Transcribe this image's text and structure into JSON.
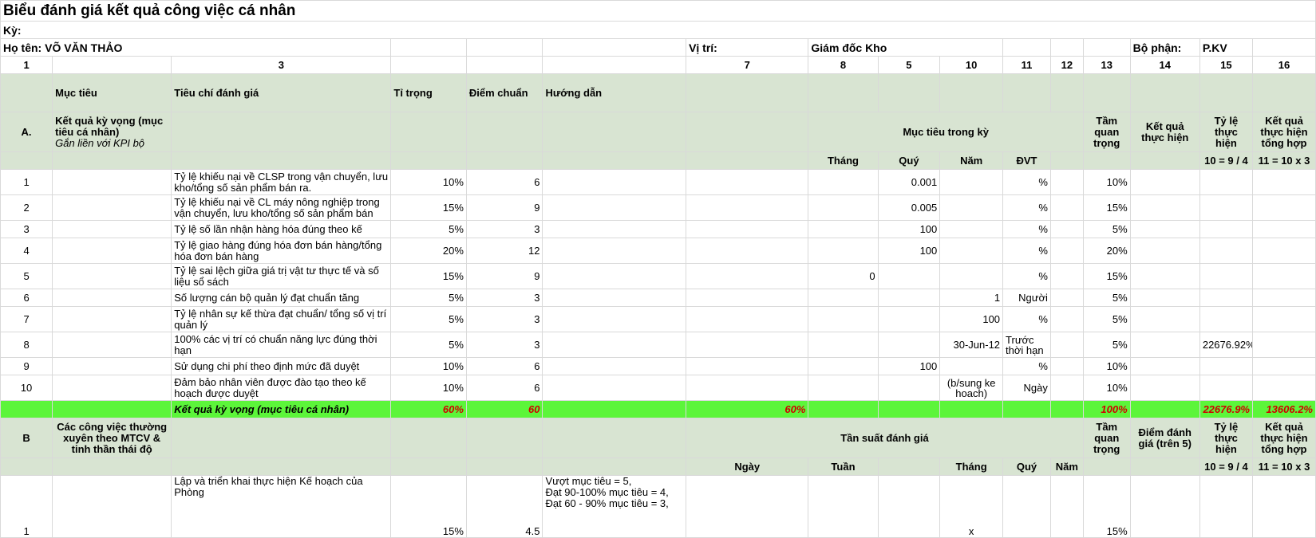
{
  "title": "Biểu đánh giá kết quả công việc cá nhân",
  "ky_label": "Kỳ:",
  "name_label": "Họ tên: VÕ VĂN THẢO",
  "position_label": "Vị trí:",
  "position_value": "Giám đốc Kho",
  "dept_label": "Bộ phận:",
  "dept_value": "P.KV",
  "col_numbers": [
    "1",
    "",
    "3",
    "",
    "",
    "",
    "7",
    "8",
    "5",
    "10",
    "11",
    "12",
    "13",
    "14",
    "15",
    "16"
  ],
  "header": {
    "muc_tieu": "Mục tiêu",
    "tieu_chi": "Tiêu chí đánh giá",
    "ti_trong": "Tỉ trọng",
    "diem_chuan": "Điểm chuẩn",
    "huong_dan": "Hướng dẫn"
  },
  "section_a": {
    "code": "A.",
    "title": "Kết quả kỳ vọng (mục tiêu cá nhân)",
    "subtitle": "Gắn liền với KPI bộ",
    "period_target": "Mục tiêu trong kỳ",
    "importance": "Tầm quan trọng",
    "result": "Kết quả thực hiện",
    "rate": "Tỷ lệ thực hiện",
    "total": "Kết quả thực hiện tổng hợp",
    "sub_cols": [
      "Tháng",
      "Quý",
      "Năm",
      "ĐVT"
    ],
    "formula_rate": "10 = 9 / 4",
    "formula_total": "11 = 10 x 3"
  },
  "rows_a": [
    {
      "no": "1",
      "criteria": "Tỷ lệ khiếu nại về CLSP trong vận chuyển, lưu kho/tổng số sản phẩm bán ra.",
      "weight": "10%",
      "score": "6",
      "thang": "",
      "quy": "0.001",
      "nam": "",
      "dvt": "%",
      "imp": "10%",
      "rate": ""
    },
    {
      "no": "2",
      "criteria": "Tỷ lệ khiếu nại về CL máy nông nghiệp  trong vận chuyển, lưu kho/tổng số sản phẩm bán",
      "weight": "15%",
      "score": "9",
      "thang": "",
      "quy": "0.005",
      "nam": "",
      "dvt": "%",
      "imp": "15%",
      "rate": ""
    },
    {
      "no": "3",
      "criteria": "Tỷ lệ số lần nhận hàng hóa đúng theo kế",
      "weight": "5%",
      "score": "3",
      "thang": "",
      "quy": "100",
      "nam": "",
      "dvt": "%",
      "imp": "5%",
      "rate": ""
    },
    {
      "no": "4",
      "criteria": "Tỷ lệ giao hàng đúng hóa đơn bán hàng/tổng hóa đơn bán hàng",
      "weight": "20%",
      "score": "12",
      "thang": "",
      "quy": "100",
      "nam": "",
      "dvt": "%",
      "imp": "20%",
      "rate": ""
    },
    {
      "no": "5",
      "criteria": "Tỷ lệ sai lệch giữa giá trị vật tư thực tế và số liệu sổ sách",
      "weight": "15%",
      "score": "9",
      "thang": "0",
      "quy": "",
      "nam": "",
      "dvt": "%",
      "imp": "15%",
      "rate": ""
    },
    {
      "no": "6",
      "criteria": "Số lượng cán bộ quản lý đạt chuẩn tăng",
      "weight": "5%",
      "score": "3",
      "thang": "",
      "quy": "",
      "nam": "1",
      "dvt": "Người",
      "imp": "5%",
      "rate": ""
    },
    {
      "no": "7",
      "criteria": "Tỷ lệ nhân sự kế thừa đạt chuẩn/ tổng số vị trí quản lý",
      "weight": "5%",
      "score": "3",
      "thang": "",
      "quy": "",
      "nam": "100",
      "dvt": "%",
      "imp": "5%",
      "rate": ""
    },
    {
      "no": "8",
      "criteria": "100% các vị trí có chuẩn năng lực đúng thời hạn",
      "weight": "5%",
      "score": "3",
      "thang": "",
      "quy": "",
      "nam": "30-Jun-12",
      "dvt": "Trước thời hạn",
      "imp": "5%",
      "rate": "22676.92%"
    },
    {
      "no": "9",
      "criteria": "Sử dụng chi phí theo định mức đã duyệt",
      "weight": "10%",
      "score": "6",
      "thang": "",
      "quy": "100",
      "nam": "",
      "dvt": "%",
      "imp": "10%",
      "rate": ""
    },
    {
      "no": "10",
      "criteria": "Đảm bảo nhân viên được đào tạo theo kế hoạch được duyệt",
      "weight": "10%",
      "score": "6",
      "thang": "",
      "quy": "",
      "nam": "(b/sung ke hoach)",
      "dvt": "Ngày",
      "imp": "10%",
      "rate": ""
    }
  ],
  "summary_a": {
    "label": "Kết quả kỳ vọng (mục tiêu cá nhân)",
    "weight": "60%",
    "score": "60",
    "col7": "60%",
    "imp": "100%",
    "rate": "22676.9%",
    "total": "13606.2%"
  },
  "section_b": {
    "code": "B",
    "title": "Các công việc thường xuyên theo MTCV & tinh thần thái độ",
    "frequency": "Tần suất đánh giá",
    "importance": "Tầm quan trọng",
    "score5": "Điểm đánh giá (trên 5)",
    "rate": "Tỷ lệ thực hiện",
    "total": "Kết quả thực hiện tổng hợp",
    "sub_cols": [
      "Ngày",
      "Tuần",
      "Tháng",
      "Quý",
      "Năm"
    ],
    "formula_rate": "10 = 9 / 4",
    "formula_total": "11 = 10 x 3"
  },
  "rows_b": [
    {
      "no": "1",
      "criteria": "Lập và triển khai thực hiện Kế hoạch của Phòng",
      "weight": "15%",
      "score": "4.5",
      "guide": [
        "Vượt mục tiêu = 5,",
        "Đạt 90-100% mục tiêu = 4,",
        "Đạt 60 - 90% mục tiêu = 3,"
      ],
      "thang": "x",
      "imp": "15%"
    }
  ]
}
